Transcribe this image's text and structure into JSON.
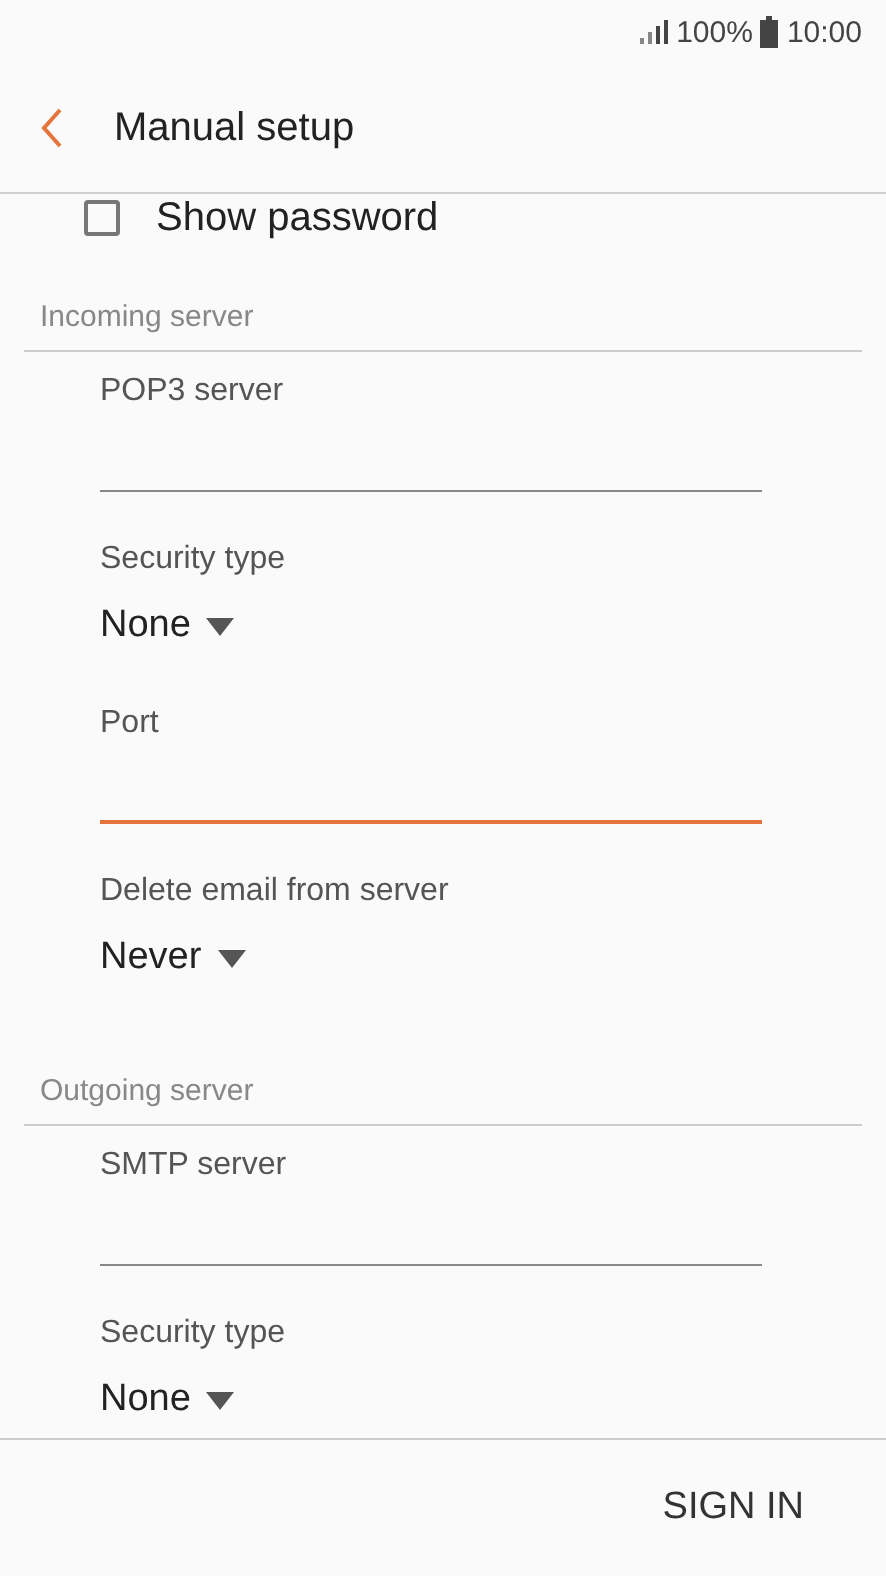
{
  "status_bar": {
    "battery": "100%",
    "time": "10:00"
  },
  "header": {
    "title": "Manual setup"
  },
  "show_password": {
    "label": "Show password",
    "checked": false
  },
  "sections": [
    {
      "title": "Incoming server",
      "items": [
        {
          "kind": "text",
          "label": "POP3 server",
          "focused": false
        },
        {
          "kind": "dropdown",
          "label": "Security type",
          "value": "None"
        },
        {
          "kind": "text",
          "label": "Port",
          "focused": true
        },
        {
          "kind": "dropdown",
          "label": "Delete email from server",
          "value": "Never"
        }
      ]
    },
    {
      "title": "Outgoing server",
      "items": [
        {
          "kind": "text",
          "label": "SMTP server",
          "focused": false
        },
        {
          "kind": "dropdown",
          "label": "Security type",
          "value": "None"
        }
      ]
    }
  ],
  "footer": {
    "button": "SIGN IN"
  }
}
